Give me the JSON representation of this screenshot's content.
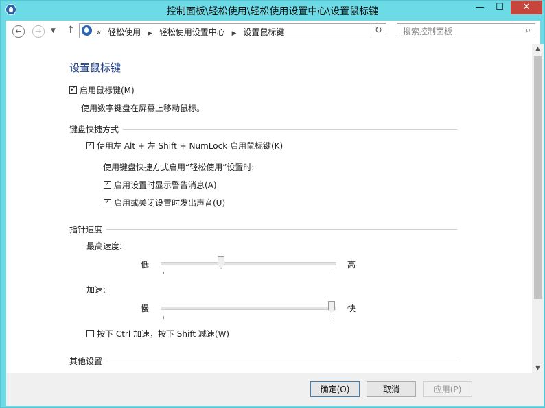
{
  "window": {
    "title": "控制面板\\轻松使用\\轻松使用设置中心\\设置鼠标键",
    "min": "—",
    "max": "☐",
    "close": "✕"
  },
  "nav": {
    "back": "←",
    "forward": "→",
    "recent": "▼",
    "up": "↑",
    "overflow": "«",
    "breadcrumbs": [
      "轻松使用",
      "轻松使用设置中心",
      "设置鼠标键"
    ],
    "sep": "▶",
    "refresh": "↻",
    "search_placeholder": "搜索控制面板",
    "search_icon": "⌕"
  },
  "page": {
    "title": "设置鼠标键",
    "enable_mousekeys": {
      "label": "启用鼠标键(M)",
      "checked": true
    },
    "enable_desc": "使用数字键盘在屏幕上移动鼠标。",
    "shortcut_section": "键盘快捷方式",
    "shortcut_enable": {
      "label": "使用左 Alt + 左 Shift + NumLock 启用鼠标键(K)",
      "checked": true
    },
    "shortcut_when": "使用键盘快捷方式启用“轻松使用”设置时:",
    "show_warning": {
      "label": "启用设置时显示警告消息(A)",
      "checked": true
    },
    "make_sound": {
      "label": "启用或关闭设置时发出声音(U)",
      "checked": true
    },
    "pointer_section": "指针速度",
    "top_speed_label": "最高速度:",
    "top_speed_low": "低",
    "top_speed_high": "高",
    "top_speed_value": 0.34,
    "accel_label": "加速:",
    "accel_low": "慢",
    "accel_high": "快",
    "accel_value": 1.0,
    "ctrl_shift": {
      "label": "按下 Ctrl 加速，按下 Shift 减速(W)",
      "checked": false
    },
    "other_section": "其他设置"
  },
  "footer": {
    "ok": "确定(O)",
    "cancel": "取消",
    "apply": "应用(P)"
  },
  "colors": {
    "titlebar": "#6ddbe6",
    "close": "#c7463c",
    "title_blue": "#1e3f8c"
  }
}
